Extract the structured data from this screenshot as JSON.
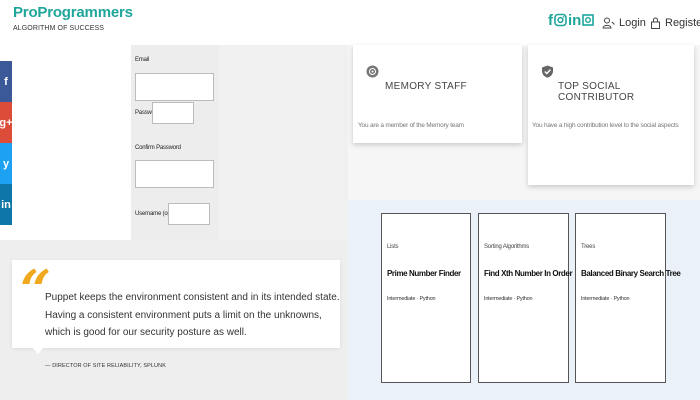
{
  "header": {
    "brand_title": "ProProgrammers",
    "brand_tagline": "ALGORITHM OF SUCCESS",
    "social_icons": [
      "facebook-icon",
      "instagram-icon",
      "linkedin-icon",
      "email-icon"
    ],
    "login_label": "Login",
    "register_label": "Register"
  },
  "share_bar": [
    {
      "icon": "facebook-icon",
      "glyph": "f"
    },
    {
      "icon": "google-plus-icon",
      "glyph": "g+"
    },
    {
      "icon": "twitter-icon",
      "glyph": "y"
    },
    {
      "icon": "linkedin-icon",
      "glyph": "in"
    }
  ],
  "form": {
    "email_label": "Email",
    "email_value": "",
    "password_label": "Password",
    "password_value": "",
    "confirm_password_label": "Confirm Password",
    "confirm_password_value": "",
    "username_label": "Username (optional)",
    "username_value": ""
  },
  "quote": {
    "mark": "“",
    "text": "Puppet keeps the environment consistent and in its intended state. Having a consistent environment puts a limit on the unknowns, which is good for our security posture as well.",
    "attribution": "— DIRECTOR OF SITE RELIABILITY, SPLUNK"
  },
  "badges": [
    {
      "icon": "memory-badge-icon",
      "title": "MEMORY STAFF",
      "description": "You are a member of the Memory team"
    },
    {
      "icon": "shield-check-icon",
      "title": "TOP SOCIAL CONTRIBUTOR",
      "description": "You have a high contribution level to the social aspects"
    }
  ],
  "algorithms": [
    {
      "category": "Lists",
      "title": "Prime Number Finder",
      "meta": "Intermediate · Python"
    },
    {
      "category": "Sorting Algorithms",
      "title": "Find Xth Number In Order",
      "meta": "Intermediate · Python"
    },
    {
      "category": "Trees",
      "title": "Balanced Binary Search Tree",
      "meta": "Intermediate · Python"
    }
  ],
  "colors": {
    "brand": "#1fa59a",
    "quote_accent": "#f0a81c",
    "facebook": "#3b5998",
    "google_plus": "#dd4b39",
    "twitter": "#1da1f2",
    "linkedin": "#0e76a8"
  }
}
